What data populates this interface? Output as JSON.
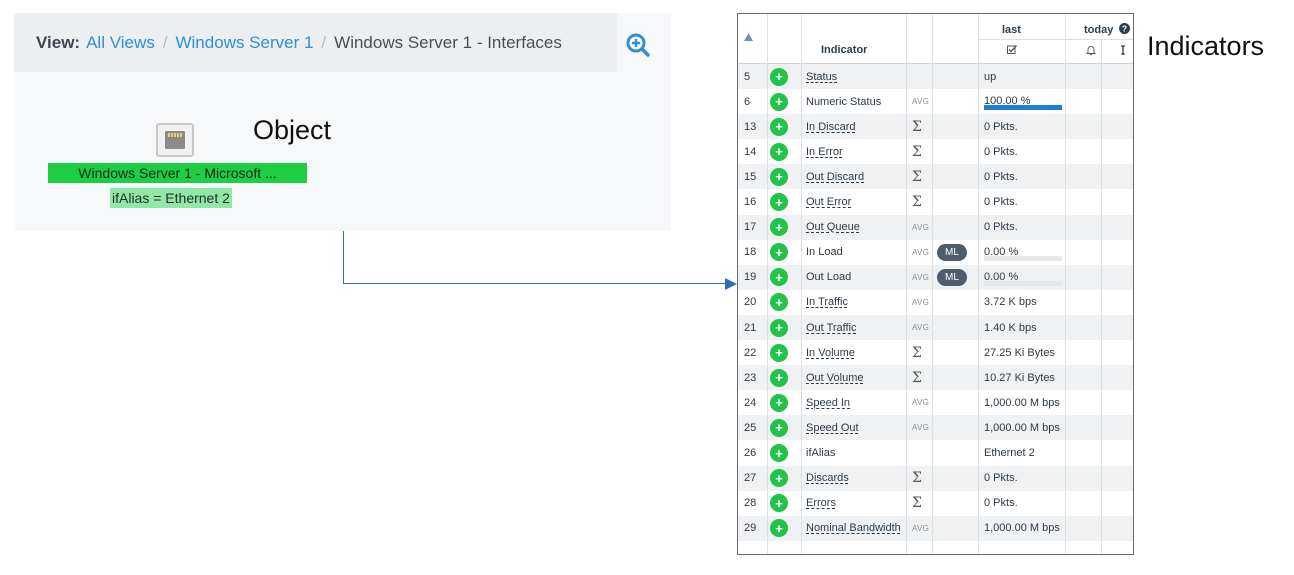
{
  "view_breadcrumb": {
    "label": "View:",
    "items": [
      "All Views",
      "Windows Server 1",
      "Windows Server 1 - Interfaces"
    ]
  },
  "object": {
    "name": "Windows Server 1 - Microsoft ...",
    "attribute": "ifAlias = Ethernet 2",
    "icon": "network-port-icon"
  },
  "labels": {
    "object": "Object",
    "indicators": "Indicators"
  },
  "table": {
    "headers": {
      "sort_icon": "sort-up-icon",
      "indicator": "Indicator",
      "last": "last",
      "today": "today",
      "help_icon": "help-icon",
      "check_icon": "check-square-icon",
      "bell_icon": "bell-icon",
      "sort_icon2": "sort-vertical-icon"
    },
    "rows": [
      {
        "id": "5",
        "name": "Status",
        "link": true,
        "agg": "",
        "ml": false,
        "last": "up",
        "bar": null
      },
      {
        "id": "6",
        "name": "Numeric Status",
        "link": false,
        "agg": "AVG",
        "ml": false,
        "last": "100.00 %",
        "bar": 1.0
      },
      {
        "id": "13",
        "name": "In Discard",
        "link": true,
        "agg": "Σ",
        "ml": false,
        "last": "0 Pkts.",
        "bar": null
      },
      {
        "id": "14",
        "name": "In Error",
        "link": true,
        "agg": "Σ",
        "ml": false,
        "last": "0 Pkts.",
        "bar": null
      },
      {
        "id": "15",
        "name": "Out Discard",
        "link": true,
        "agg": "Σ",
        "ml": false,
        "last": "0 Pkts.",
        "bar": null
      },
      {
        "id": "16",
        "name": "Out Error",
        "link": true,
        "agg": "Σ",
        "ml": false,
        "last": "0 Pkts.",
        "bar": null
      },
      {
        "id": "17",
        "name": "Out Queue",
        "link": true,
        "agg": "AVG",
        "ml": false,
        "last": "0 Pkts.",
        "bar": null
      },
      {
        "id": "18",
        "name": "In Load",
        "link": false,
        "agg": "AVG",
        "ml": true,
        "last": "0.00 %",
        "bar": 0.0
      },
      {
        "id": "19",
        "name": "Out Load",
        "link": false,
        "agg": "AVG",
        "ml": true,
        "last": "0.00 %",
        "bar": 0.0
      },
      {
        "id": "20",
        "name": "In Traffic",
        "link": true,
        "agg": "AVG",
        "ml": false,
        "last": "3.72 K bps",
        "bar": null
      },
      {
        "id": "21",
        "name": "Out Traffic",
        "link": true,
        "agg": "AVG",
        "ml": false,
        "last": "1.40 K bps",
        "bar": null
      },
      {
        "id": "22",
        "name": "In Volume",
        "link": true,
        "agg": "Σ",
        "ml": false,
        "last": "27.25 Ki Bytes",
        "bar": null
      },
      {
        "id": "23",
        "name": "Out Volume",
        "link": true,
        "agg": "Σ",
        "ml": false,
        "last": "10.27 Ki Bytes",
        "bar": null
      },
      {
        "id": "24",
        "name": "Speed In",
        "link": true,
        "agg": "AVG",
        "ml": false,
        "last": "1,000.00 M bps",
        "bar": null
      },
      {
        "id": "25",
        "name": "Speed Out",
        "link": true,
        "agg": "AVG",
        "ml": false,
        "last": "1,000.00 M bps",
        "bar": null
      },
      {
        "id": "26",
        "name": "ifAlias",
        "link": false,
        "agg": "",
        "ml": false,
        "last": "Ethernet 2",
        "bar": null
      },
      {
        "id": "27",
        "name": "Discards",
        "link": true,
        "agg": "Σ",
        "ml": false,
        "last": "0 Pkts.",
        "bar": null
      },
      {
        "id": "28",
        "name": "Errors",
        "link": true,
        "agg": "Σ",
        "ml": false,
        "last": "0 Pkts.",
        "bar": null
      },
      {
        "id": "29",
        "name": "Nominal Bandwidth",
        "link": true,
        "agg": "AVG",
        "ml": false,
        "last": "1,000.00 M bps",
        "bar": null
      }
    ],
    "add_label": "+",
    "ml_label": "ML"
  },
  "colors": {
    "accent_link": "#2e8fd8",
    "object_green": "#1dce44",
    "add_green": "#22c34b",
    "connector": "#2f6db8",
    "bar_blue": "#1f7fd6"
  }
}
